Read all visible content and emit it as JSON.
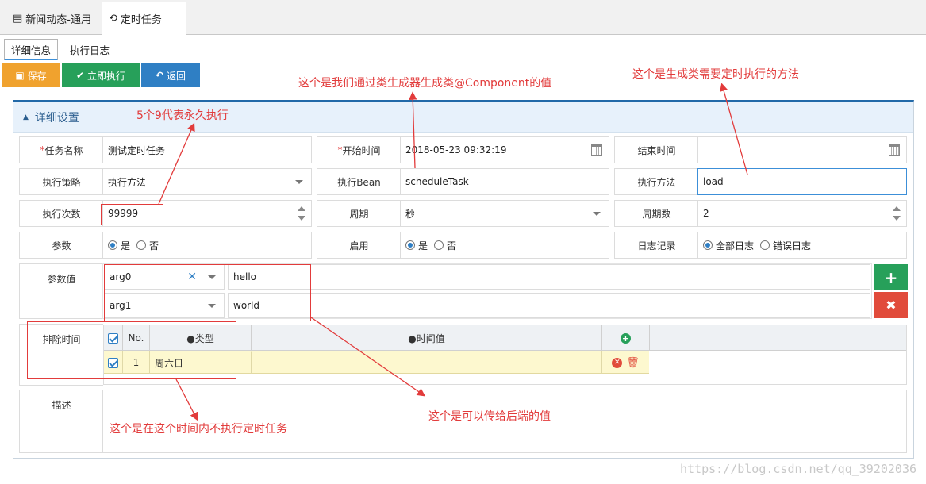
{
  "top_tabs": [
    {
      "label": "新闻动态-通用",
      "icon": "newspaper-icon"
    },
    {
      "label": "定时任务",
      "icon": "history-clock-icon"
    }
  ],
  "sub_tabs": [
    {
      "label": "详细信息"
    },
    {
      "label": "执行日志"
    }
  ],
  "toolbar": {
    "save": "保存",
    "run": "立即执行",
    "back": "返回"
  },
  "panel": {
    "title": "详细设置"
  },
  "fields": {
    "task_name": {
      "label": "任务名称",
      "required": "*",
      "value": "测试定时任务"
    },
    "start_time": {
      "label": "开始时间",
      "required": "*",
      "value": "2018-05-23 09:32:19"
    },
    "end_time": {
      "label": "结束时间",
      "value": ""
    },
    "strategy": {
      "label": "执行策略",
      "value": "执行方法"
    },
    "bean": {
      "label": "执行Bean",
      "value": "scheduleTask"
    },
    "method": {
      "label": "执行方法",
      "value": "load"
    },
    "count": {
      "label": "执行次数",
      "value": "99999"
    },
    "period": {
      "label": "周期",
      "value": "秒"
    },
    "period_num": {
      "label": "周期数",
      "value": "2"
    },
    "params": {
      "label": "参数",
      "yes": "是",
      "no": "否"
    },
    "enabled": {
      "label": "启用",
      "yes": "是",
      "no": "否"
    },
    "log": {
      "label": "日志记录",
      "all": "全部日志",
      "error": "错误日志"
    },
    "param_values": {
      "label": "参数值",
      "rows": [
        {
          "name": "arg0",
          "value": "hello"
        },
        {
          "name": "arg1",
          "value": "world"
        }
      ]
    },
    "exclude": {
      "label": "排除时间",
      "headers": {
        "no": "No.",
        "type": "●类型",
        "value": "●时间值"
      },
      "rows": [
        {
          "no": "1",
          "type": "周六日",
          "value": ""
        }
      ]
    },
    "desc": {
      "label": "描述",
      "value": ""
    }
  },
  "annotations": {
    "forever": "5个9代表永久执行",
    "component": "这个是我们通过类生成器生成类@Component的值",
    "method": "这个是生成类需要定时执行的方法",
    "exclude": "这个是在这个时间内不执行定时任务",
    "backend": "这个是可以传给后端的值"
  },
  "watermark": "https://blog.csdn.net/qq_39202036",
  "colors": {
    "save": "#f0a22e",
    "run": "#27a05a",
    "back": "#2f7fc4",
    "annotation": "#e23b3b",
    "panel_border": "#2269a8"
  }
}
